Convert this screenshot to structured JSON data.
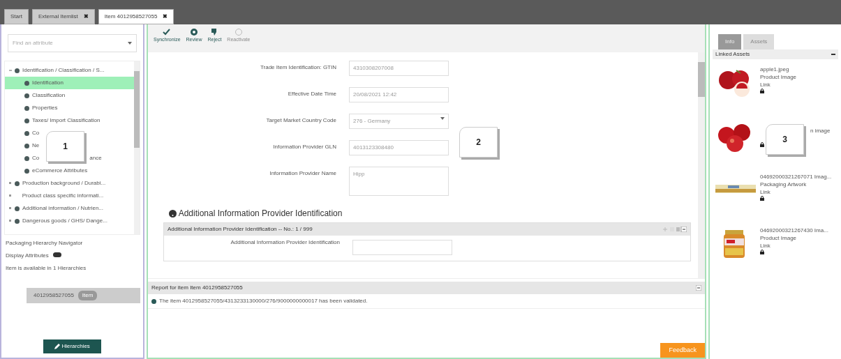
{
  "tabs": [
    {
      "label": "Start",
      "selected": false
    },
    {
      "label": "External Itemlist",
      "close": "✖",
      "selected": false
    },
    {
      "label": "Item 4012958527055",
      "close": "✖",
      "selected": true
    }
  ],
  "left_panel": {
    "search": {
      "placeholder": "Find an attribute"
    },
    "tree": [
      {
        "label": "Identification / Classification / S...",
        "icon": true,
        "expanded": true,
        "children": [
          {
            "label": "Identification",
            "selected": true
          },
          {
            "label": "Classification",
            "selected": false
          },
          {
            "label": "Properties",
            "selected": false
          },
          {
            "label": "Taxes/ Import Classification",
            "selected": false
          },
          {
            "label": "Co",
            "selected": false
          },
          {
            "label": "Ne",
            "selected": false
          },
          {
            "label": "Co",
            "label_end": "ance",
            "selected": false
          },
          {
            "label": "eCommerce Attributes",
            "selected": false
          }
        ]
      },
      {
        "label": "Production background / Durabi...",
        "icon": true,
        "expanded": false
      },
      {
        "label": "Product class specific informati...",
        "icon": false,
        "expanded": false
      },
      {
        "label": "Additional information / Nutrien...",
        "icon": true,
        "expanded": false
      },
      {
        "label": "Dangerous goods / GHS/ Dange...",
        "icon": true,
        "expanded": false
      }
    ],
    "navigator_title": "Packaging Hierarchy Navigator",
    "display_attributes": {
      "label": "Display Attributes",
      "on": true
    },
    "availability": "Item is available in 1 Hierarchies",
    "hierarchy_node": {
      "label": "4012958527055",
      "badge": "Item"
    },
    "button": "Hierarchies"
  },
  "toolbar": [
    {
      "label": "Synchronize",
      "disabled": false
    },
    {
      "label": "Review",
      "disabled": false
    },
    {
      "label": "Reject",
      "disabled": false
    },
    {
      "label": "Reactivate",
      "disabled": true
    }
  ],
  "form": [
    {
      "label": "Trade Item Identification: GTIN",
      "value": "4310308207008",
      "kind": "input"
    },
    {
      "label": "Effective Date Time",
      "value": "20/08/2021 12:42",
      "kind": "input"
    },
    {
      "label": "Target Market Country Code",
      "value": "276 - Germany",
      "kind": "select"
    },
    {
      "label": "Information Provider GLN",
      "value": "4013123308480",
      "kind": "input"
    },
    {
      "label": "Information Provider Name",
      "value": "Hipp",
      "kind": "textarea"
    }
  ],
  "section": {
    "title": "Additional Information Provider Identification",
    "panel_title": "Additional Information Provider Identification -- No.: 1 / 999",
    "field_label": "Additional Information Provider Identification"
  },
  "report": {
    "title": "Report for item Item 4012958527055",
    "message": "The item 4012958527055/4313233130000/276/9000000000017 has been validated."
  },
  "feedback_button": "Feedback",
  "right_panel": {
    "tabs": [
      {
        "label": "Info",
        "selected": true
      },
      {
        "label": "Assets",
        "selected": false
      }
    ],
    "header": "Linked Assets",
    "assets": [
      {
        "name": "apple1.jpeg",
        "type": "Product Image",
        "link": "Link"
      },
      {
        "type": "n image"
      },
      {
        "name": "04692000321267071 Imag...",
        "type": "Packaging Artwork",
        "link": "Link"
      },
      {
        "name": "04692000321267430 Ima...",
        "type": "Product Image",
        "link": "Link"
      }
    ]
  },
  "callouts": [
    {
      "number": "1"
    },
    {
      "number": "2"
    },
    {
      "number": "3"
    }
  ]
}
